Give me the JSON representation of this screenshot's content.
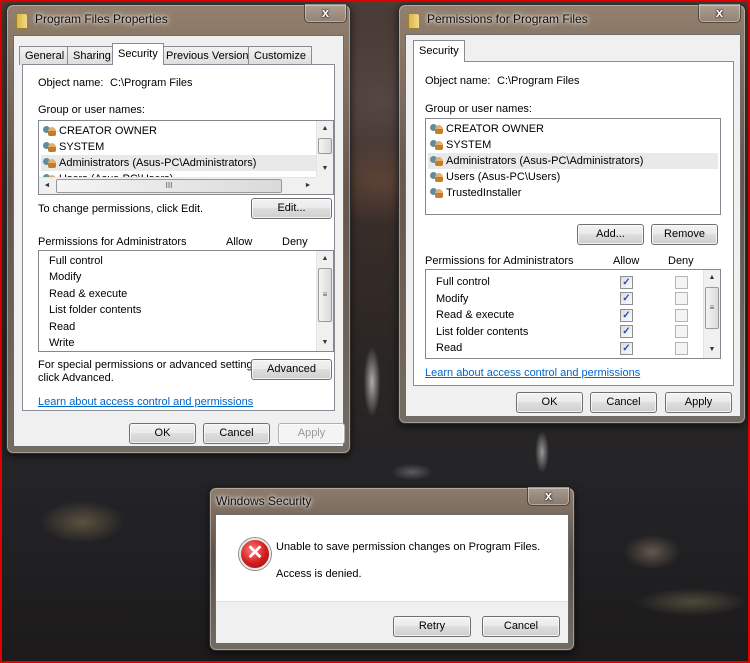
{
  "properties_dialog": {
    "title": "Program Files Properties",
    "close_label": "x",
    "tabs": [
      {
        "label": "General",
        "active": false
      },
      {
        "label": "Sharing",
        "active": false
      },
      {
        "label": "Security",
        "active": true
      },
      {
        "label": "Previous Versions",
        "active": false
      },
      {
        "label": "Customize",
        "active": false
      }
    ],
    "object_name_label": "Object name:",
    "object_name_value": "C:\\Program Files",
    "group_label": "Group or user names:",
    "users": [
      {
        "name": "CREATOR OWNER",
        "selected": false
      },
      {
        "name": "SYSTEM",
        "selected": false
      },
      {
        "name": "Administrators (Asus-PC\\Administrators)",
        "selected": true
      },
      {
        "name": "Users (Asus-PC\\Users)",
        "selected": false
      }
    ],
    "scroll_left": "◄",
    "scroll_right": "►",
    "scroll_up": "▲",
    "scroll_down": "▼",
    "hthumb_grip": "III",
    "vthumb_grip": "≡",
    "change_hint": "To change permissions, click Edit.",
    "edit_button": "Edit...",
    "permissions_label": "Permissions for Administrators",
    "allow_header": "Allow",
    "deny_header": "Deny",
    "permissions": [
      "Full control",
      "Modify",
      "Read & execute",
      "List folder contents",
      "Read",
      "Write"
    ],
    "advanced_hint_line1": "For special permissions or advanced settings,",
    "advanced_hint_line2": "click Advanced.",
    "advanced_button": "Advanced",
    "learn_link": "Learn about access control and permissions",
    "ok_button": "OK",
    "cancel_button": "Cancel",
    "apply_button": "Apply",
    "apply_enabled": false
  },
  "permissions_dialog": {
    "title": "Permissions for Program Files",
    "close_label": "x",
    "tab": "Security",
    "object_name_label": "Object name:",
    "object_name_value": "C:\\Program Files",
    "group_label": "Group or user names:",
    "users": [
      {
        "name": "CREATOR OWNER",
        "selected": false
      },
      {
        "name": "SYSTEM",
        "selected": false
      },
      {
        "name": "Administrators (Asus-PC\\Administrators)",
        "selected": true
      },
      {
        "name": "Users (Asus-PC\\Users)",
        "selected": false
      },
      {
        "name": "TrustedInstaller",
        "selected": false
      }
    ],
    "add_button": "Add...",
    "remove_button": "Remove",
    "permissions_label": "Permissions for Administrators",
    "allow_header": "Allow",
    "deny_header": "Deny",
    "permissions": [
      {
        "name": "Full control",
        "allow": true,
        "deny": false
      },
      {
        "name": "Modify",
        "allow": true,
        "deny": false
      },
      {
        "name": "Read & execute",
        "allow": true,
        "deny": false
      },
      {
        "name": "List folder contents",
        "allow": true,
        "deny": false
      },
      {
        "name": "Read",
        "allow": true,
        "deny": false
      }
    ],
    "checkmark": "✓",
    "scroll_up": "▲",
    "scroll_down": "▼",
    "vthumb_grip": "≡",
    "learn_link": "Learn about access control and permissions",
    "ok_button": "OK",
    "cancel_button": "Cancel",
    "apply_button": "Apply"
  },
  "error_dialog": {
    "title": "Windows Security",
    "close_label": "x",
    "icon_glyph": "✕",
    "message": "Unable to save permission changes on Program Files.",
    "detail": "Access is denied.",
    "retry_button": "Retry",
    "cancel_button": "Cancel"
  },
  "colors": {
    "frame_border": "#e00000",
    "link": "#0066cc",
    "check": "#2a4fb5",
    "error_red": "#d21c1c"
  }
}
